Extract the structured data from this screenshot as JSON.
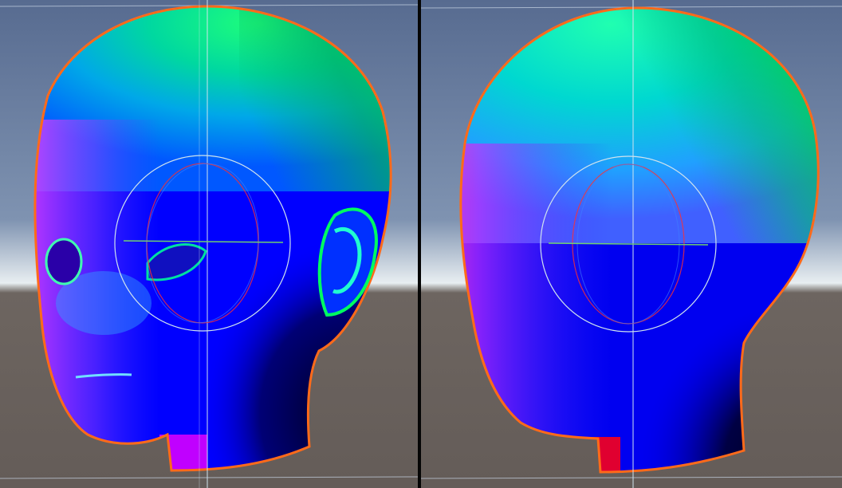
{
  "scene": {
    "background": {
      "sky_top": "#5a6f93",
      "sky_mid": "#8a9fba",
      "horizon": "#e6ecef",
      "ground": "#6a625e"
    },
    "outline_color": "#ff6a1a",
    "gizmo_color": "#cfe3ee",
    "divider_color": "#050505"
  },
  "viewports": [
    {
      "name": "three-quarter-view"
    },
    {
      "name": "side-view"
    }
  ]
}
